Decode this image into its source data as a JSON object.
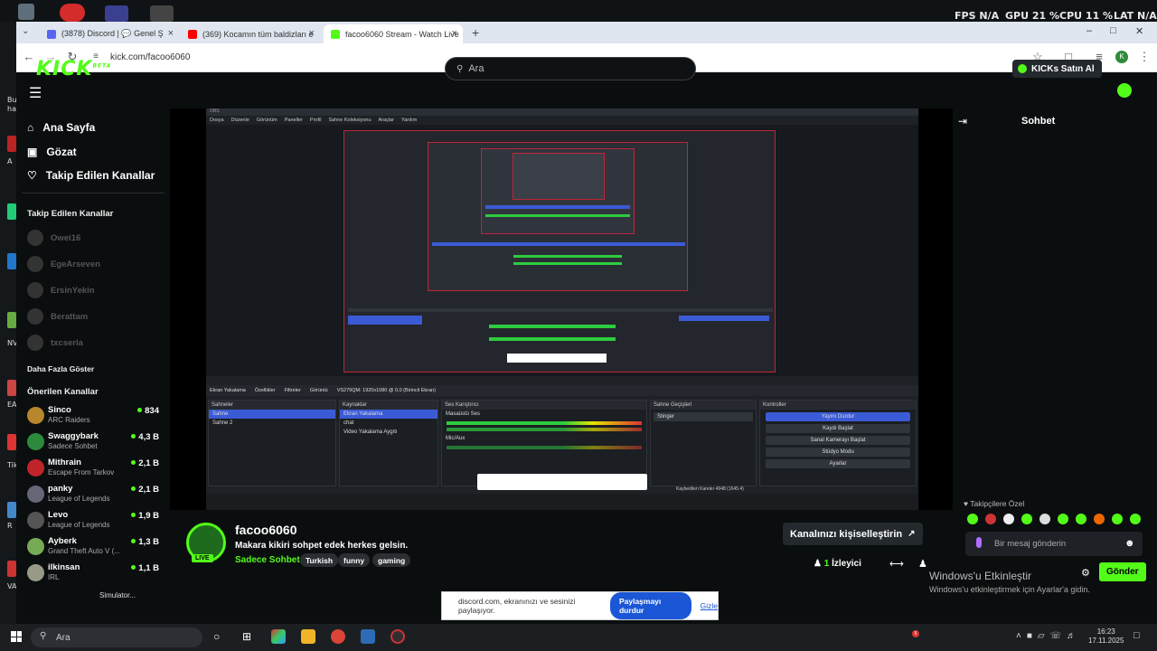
{
  "perf": {
    "fps_label": "FPS",
    "fps": "N/A",
    "gpu_label": "GPU",
    "gpu": "21 %",
    "cpu_label": "CPU",
    "cpu": "11 %",
    "lat_label": "LAT",
    "lat": "N/A"
  },
  "desktop": {
    "labels": [
      "Bu",
      "ha",
      "A",
      "NV",
      "EA",
      "Tik",
      "R",
      "VA"
    ]
  },
  "tabs": [
    {
      "title": "(3878) Discord | 💬 Genel Ş"
    },
    {
      "title": "(369) Kocamın tüm baldizları e"
    },
    {
      "title": "facoo6060 Stream - Watch Live"
    }
  ],
  "url": "kick.com/facoo6060",
  "kick": {
    "logo": "KICK",
    "logo_beta": "BETA",
    "search_placeholder": "Ara",
    "buy": "KICKs Satın Al",
    "nav": [
      {
        "label": "Ana Sayfa"
      },
      {
        "label": "Gözat"
      },
      {
        "label": "Takip Edilen Kanallar"
      }
    ],
    "followed_title": "Takip Edilen Kanallar",
    "followed": [
      {
        "name": "Owei16"
      },
      {
        "name": "EgeArseven"
      },
      {
        "name": "ErsinYekin"
      },
      {
        "name": "Berattam"
      },
      {
        "name": "txcserla"
      }
    ],
    "show_more": "Daha Fazla Göster",
    "recommended_title": "Önerilen Kanallar",
    "recommended": [
      {
        "name": "Sinco",
        "category": "ARC Raiders",
        "viewers": "834"
      },
      {
        "name": "Swaggybark",
        "category": "Sadece Sohbet",
        "viewers": "4,3 B"
      },
      {
        "name": "Mithrain",
        "category": "Escape From Tarkov",
        "viewers": "2,1 B"
      },
      {
        "name": "panky",
        "category": "League of Legends",
        "viewers": "2,1 B"
      },
      {
        "name": "Levo",
        "category": "League of Legends",
        "viewers": "1,9 B"
      },
      {
        "name": "Ayberk",
        "category": "Grand Theft Auto V (...",
        "viewers": "1,3 B"
      },
      {
        "name": "ilkinsan",
        "category": "IRL",
        "viewers": "1,1 B"
      }
    ],
    "live_badge": "LIVE",
    "channel": "facoo6060",
    "stream_title": "Makara kikiri sohpet edek herkes gelsin.",
    "category": "Sadece Sohbet",
    "tags": [
      "Turkish",
      "funny",
      "gaming"
    ],
    "customize": "Kanalınızı kişiselleştirin",
    "viewer_count": "1",
    "viewer_label": "İzleyici",
    "chat_title": "Sohbet",
    "sub_emotes": "Takipçilere Özel",
    "chat_placeholder": "Bir mesaj gönderin",
    "send": "Gönder"
  },
  "obs": {
    "menu": [
      "Dosya",
      "Düzenle",
      "Görünüm",
      "Paneller",
      "Profil",
      "Sahne Koleksiyonu",
      "Araçlar",
      "Yardım"
    ],
    "source_bar": [
      "Ekran Yakalama",
      "Özellikler",
      "Filtreler",
      "Görüntü",
      "VS279QM: 1920x1080 @ 0,0 (Birincil Ekran)"
    ],
    "scenes_title": "Sahneler",
    "scenes": [
      "Sahne",
      "Sahne 2"
    ],
    "sources_title": "Kaynaklar",
    "sources": [
      "Ekran Yakalama",
      "chat",
      "Video Yakalama Aygıtı"
    ],
    "mixer_title": "Ses Karıştırıcı",
    "mixer": [
      "Masaüstü Ses",
      "Mic/Aux"
    ],
    "transitions_title": "Sahne Geçişleri",
    "transition": "Stinger",
    "controls_title": "Kontroller",
    "controls": [
      "Yayını Durdur",
      "Kaydı Başlat",
      "Sanal Kamerayı Başlat",
      "Stüdyo Modu",
      "Ayarlar"
    ],
    "status": "Kaybedilen Kareler 4948 (1645.4)"
  },
  "windows_activate": {
    "title": "Windows'u Etkinleştir",
    "sub": "Windows'u etkinleştirmek için Ayarlar'a gidin."
  },
  "simulator": "Simulator...",
  "share_bar": {
    "text": "discord.com, ekranınızı ve sesinizi paylaşıyor.",
    "stop": "Paylaşmayı durdur",
    "hide": "Gizle"
  },
  "taskbar": {
    "search": "Ara",
    "time": "16:23",
    "date": "17.11.2025",
    "badge": "5"
  },
  "colors": {
    "kick_green": "#53fc18",
    "obs_blue": "#3b5bd6",
    "share_blue": "#1a56d6"
  }
}
